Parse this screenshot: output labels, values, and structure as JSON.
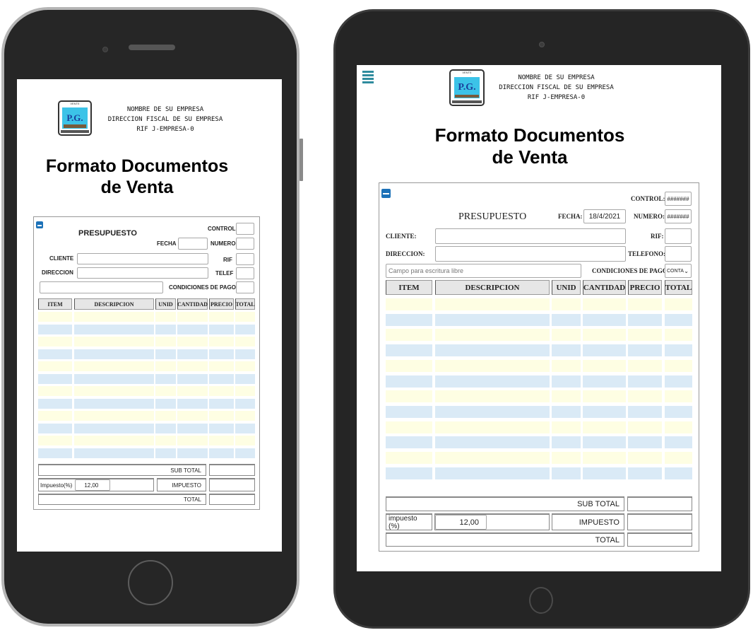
{
  "company": {
    "name": "NOMBRE DE SU EMPRESA",
    "address": "DIRECCION FISCAL DE SU EMPRESA",
    "rif": "RIF J-EMPRESA-0",
    "logo_text": "P.G.",
    "logo_caption": "VENTE"
  },
  "page_title_line1": "Formato Documentos",
  "page_title_line2": "de Venta",
  "colors": {
    "accent": "#1d72b8",
    "row_yellow": "#fefee3",
    "row_blue": "#daeaf6",
    "header_gray": "#e6e6e6"
  },
  "phone": {
    "doc_type": "PRESUPUESTO",
    "labels": {
      "control": "CONTROL",
      "fecha": "FECHA",
      "numero": "NUMERO",
      "cliente": "CLIENTE",
      "rif": "RIF",
      "direccion": "DIRECCION",
      "telef": "TELEF",
      "condiciones": "CONDICIONES DE PAGO"
    },
    "values": {
      "control": "",
      "fecha": "",
      "numero": "",
      "cliente": "",
      "rif": "",
      "direccion": "",
      "telef": "",
      "free_text": "",
      "condiciones": ""
    },
    "columns": [
      "ITEM",
      "DESCRIPCION",
      "UNID",
      "CANTIDAD",
      "PRECIO",
      "TOTAL"
    ],
    "row_count": 12,
    "totals": {
      "subtotal_label": "SUB TOTAL",
      "impuesto_pct_label": "Impuesto(%)",
      "impuesto_pct_value": "12,00",
      "impuesto_label": "IMPUESTO",
      "total_label": "TOTAL",
      "subtotal_value": "",
      "impuesto_value": "",
      "total_value": ""
    }
  },
  "tablet": {
    "doc_type": "PRESUPUESTO",
    "labels": {
      "control": "CONTROL:",
      "fecha": "FECHA:",
      "numero": "NUMERO:",
      "cliente": "CLIENTE:",
      "rif": "RIF:",
      "direccion": "DIRECCION:",
      "telefono": "TELEFONO:",
      "condiciones": "CONDICIONES DE PAGO:"
    },
    "values": {
      "control": "#######",
      "fecha": "18/4/2021",
      "numero": "#######",
      "cliente": "",
      "rif": "",
      "direccion": "",
      "telefono": "",
      "condiciones": "CONTA"
    },
    "free_text_placeholder": "Campo para escritura libre",
    "columns": [
      "ITEM",
      "DESCRIPCION",
      "UNID",
      "CANTIDAD",
      "PRECIO",
      "TOTAL"
    ],
    "row_count": 12,
    "totals": {
      "subtotal_label": "SUB TOTAL",
      "impuesto_pct_label": "impuesto (%)",
      "impuesto_pct_value": "12,00",
      "impuesto_label": "IMPUESTO",
      "total_label": "TOTAL",
      "subtotal_value": "",
      "impuesto_value": "",
      "total_value": ""
    }
  }
}
